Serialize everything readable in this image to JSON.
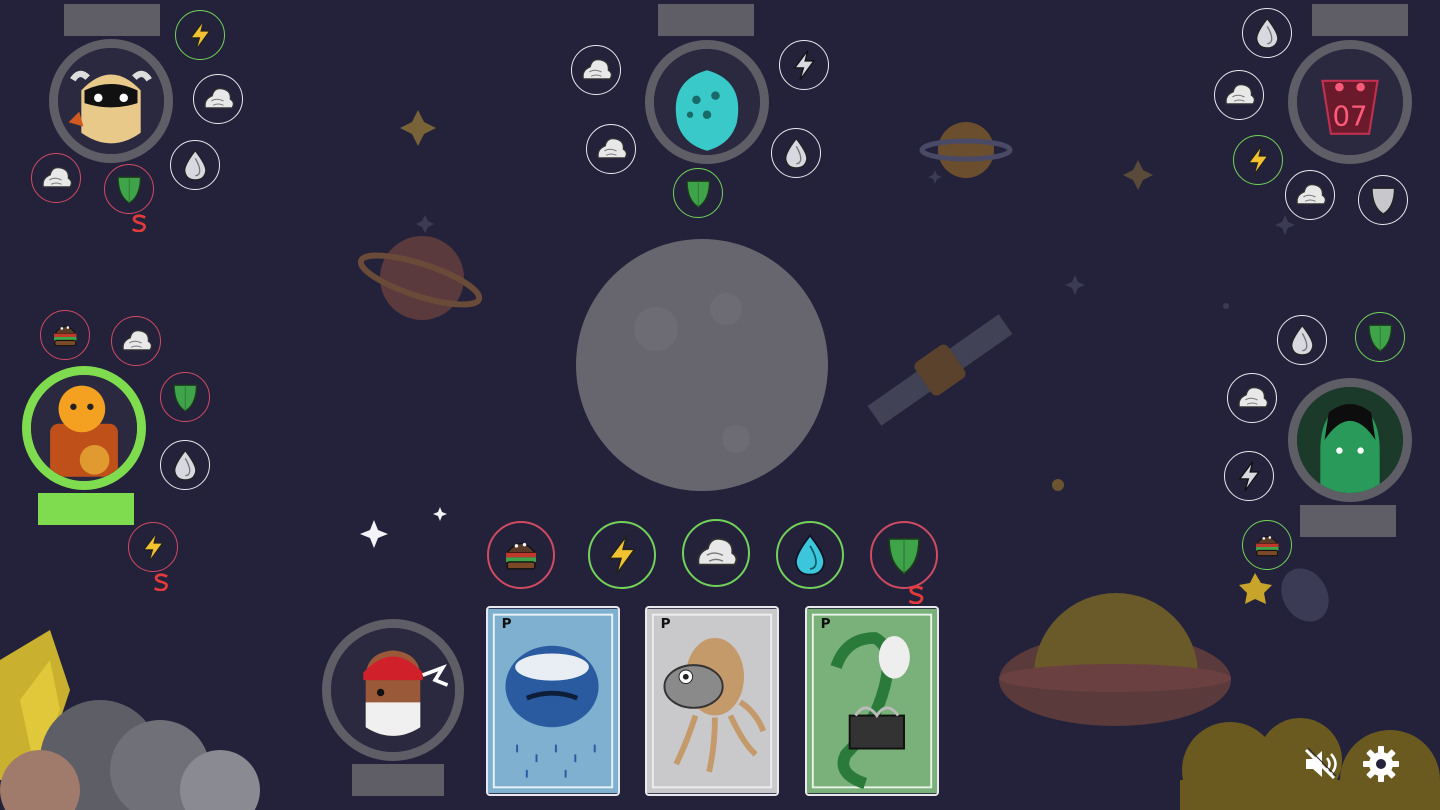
{
  "game": {
    "colors": {
      "background": "#23223a",
      "ring": "#5f5e66",
      "active_ring": "#7fdc4f",
      "token_border": "#e8e8ee",
      "token_green": "#72d25a",
      "token_red": "#cf4b62"
    },
    "center_pile": {
      "icon": "empty-pile-icon"
    },
    "players": [
      {
        "seat": "top-left",
        "avatar": "viking-avatar",
        "active": false,
        "tokens": [
          "lightning-icon",
          "rock-icon",
          "water-drop-icon",
          "shield-icon",
          "rock-icon"
        ]
      },
      {
        "seat": "top-center",
        "avatar": "blue-alien-avatar",
        "active": false,
        "tokens": [
          "rock-icon",
          "lightning-icon",
          "water-drop-icon",
          "shield-icon",
          "rock-icon"
        ]
      },
      {
        "seat": "top-right",
        "avatar": "red-demon-avatar",
        "active": false,
        "tokens": [
          "water-drop-icon",
          "rock-icon",
          "lightning-icon",
          "rock-icon",
          "shield-icon"
        ]
      },
      {
        "seat": "left",
        "avatar": "orange-robot-avatar",
        "active": true,
        "tokens": [
          "burger-icon",
          "rock-icon",
          "shield-icon",
          "water-drop-icon",
          "lightning-icon"
        ]
      },
      {
        "seat": "right",
        "avatar": "green-helmet-avatar",
        "active": false,
        "tokens": [
          "water-drop-icon",
          "shield-icon",
          "rock-icon",
          "lightning-icon",
          "burger-icon"
        ]
      },
      {
        "seat": "bottom",
        "avatar": "bandana-avatar",
        "active": false,
        "tokens": [
          "burger-icon",
          "lightning-icon",
          "rock-icon",
          "water-drop-icon",
          "shield-icon"
        ]
      }
    ],
    "hand": [
      {
        "name": "pufferfish-card",
        "letter": "P"
      },
      {
        "name": "octopus-card",
        "letter": "P"
      },
      {
        "name": "lizard-card",
        "letter": "P"
      }
    ],
    "controls": {
      "mute": "mute-icon",
      "settings": "gear-icon"
    }
  }
}
